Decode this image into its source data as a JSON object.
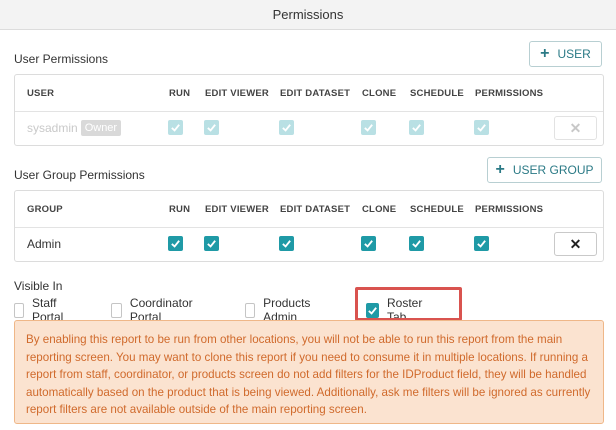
{
  "title": "Permissions",
  "user_permissions": {
    "heading": "User Permissions",
    "add_button": "USER",
    "columns": [
      "USER",
      "RUN",
      "EDIT VIEWER",
      "EDIT DATASET",
      "CLONE",
      "SCHEDULE",
      "PERMISSIONS"
    ],
    "rows": [
      {
        "name": "sysadmin",
        "badge": "Owner",
        "run": true,
        "edit_viewer": true,
        "edit_dataset": true,
        "clone": true,
        "schedule": true,
        "permissions": true,
        "disabled": true
      }
    ]
  },
  "group_permissions": {
    "heading": "User Group Permissions",
    "add_button": "USER GROUP",
    "columns": [
      "GROUP",
      "RUN",
      "EDIT VIEWER",
      "EDIT DATASET",
      "CLONE",
      "SCHEDULE",
      "PERMISSIONS"
    ],
    "rows": [
      {
        "name": "Admin",
        "run": true,
        "edit_viewer": true,
        "edit_dataset": true,
        "clone": true,
        "schedule": true,
        "permissions": true,
        "disabled": false
      }
    ]
  },
  "visible_in": {
    "heading": "Visible In",
    "options": [
      {
        "label": "Staff Portal",
        "checked": false
      },
      {
        "label": "Coordinator Portal",
        "checked": false
      },
      {
        "label": "Products Admin",
        "checked": false
      },
      {
        "label": "Roster Tab",
        "checked": true
      }
    ]
  },
  "notice": "By enabling this report to be run from other locations, you will not be able to run this report from the main reporting screen. You may want to clone this report if you need to consume it in multiple locations. If running a report from staff, coordinator, or products screen do not add filters for the IDProduct field, they will be handled automatically based on the product that is being viewed. Additionally, ask me filters will be ignored as currently report filters are not available outside of the main reporting screen.",
  "colors": {
    "accent": "#1f9aa6",
    "highlight": "#d9534f",
    "notice_bg": "#fbe3d0",
    "notice_text": "#d06a2c"
  },
  "icons": {
    "add": "plus-icon",
    "remove": "close-icon",
    "check": "check-icon"
  }
}
